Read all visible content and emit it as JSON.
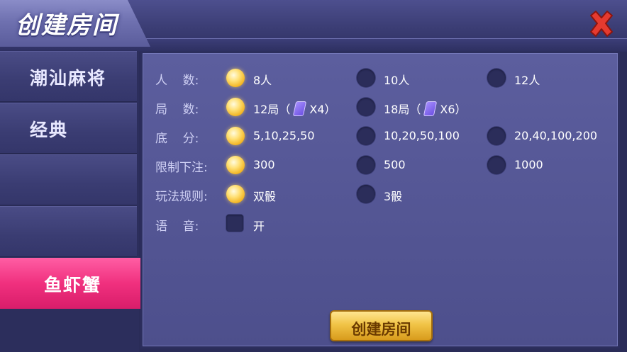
{
  "window": {
    "title": "创建房间"
  },
  "sidebar": {
    "items": [
      {
        "label": "潮汕麻将",
        "active": false
      },
      {
        "label": "经典",
        "active": false
      },
      {
        "label": "",
        "active": false
      },
      {
        "label": "",
        "active": false
      },
      {
        "label": "鱼虾蟹",
        "active": true
      }
    ]
  },
  "settings": {
    "players": {
      "label": "人    数:",
      "options": [
        "8人",
        "10人",
        "12人"
      ],
      "selected": 0
    },
    "rounds": {
      "label": "局    数:",
      "options": [
        {
          "text": "12局（",
          "cost": "X4）"
        },
        {
          "text": "18局（",
          "cost": "X6）"
        }
      ],
      "selected": 0
    },
    "base": {
      "label": "底    分:",
      "options": [
        "5,10,25,50",
        "10,20,50,100",
        "20,40,100,200"
      ],
      "selected": 0
    },
    "limit": {
      "label": "限制下注:",
      "options": [
        "300",
        "500",
        "1000"
      ],
      "selected": 0
    },
    "rules": {
      "label": "玩法规则:",
      "options": [
        "双骰",
        "3骰"
      ],
      "selected": 0
    },
    "voice": {
      "label": "语    音:",
      "option": "开",
      "checked": false
    }
  },
  "actions": {
    "create": "创建房间"
  },
  "colors": {
    "accent_active": "#f0307e",
    "radio_on": "#f2b21d",
    "close": "#e53a2f"
  },
  "icons": {
    "close": "close-icon",
    "card": "room-card-icon"
  }
}
